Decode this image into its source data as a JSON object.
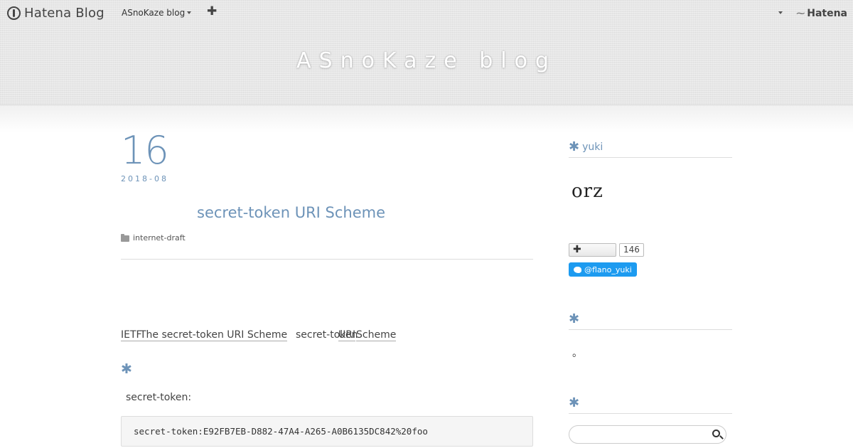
{
  "globalheader": {
    "logo_text": "Hatena Blog",
    "blog_switch": "ASnoKaze blog",
    "plus": "✚",
    "hatena": "Hatena"
  },
  "blog": {
    "title": "ASnoKaze blog"
  },
  "entry": {
    "day": "16",
    "year_month": "2018-08",
    "title": "secret-token URI Scheme",
    "category": "internet-draft",
    "body": {
      "ietf": "IETF",
      "link": "The secret-token URI Scheme",
      "text1": "secret-token",
      "uri": "URI",
      "scheme": "Scheme"
    },
    "section_star": "✱",
    "sub_label": "secret-token:",
    "code": "secret-token:E92FB7EB-D882-47A4-A265-A0B6135DC842%20foo"
  },
  "sidebar": {
    "profile_title": "yuki",
    "avatar_text": "orz",
    "subscribe_plus": "✚",
    "subscribe_count": "146",
    "twitter": "@flano_yuki",
    "star": "✱",
    "note": "。"
  },
  "search": {
    "placeholder": ""
  },
  "colors": {
    "accent": "#6d93b8",
    "twitter": "#1d9bf0"
  }
}
